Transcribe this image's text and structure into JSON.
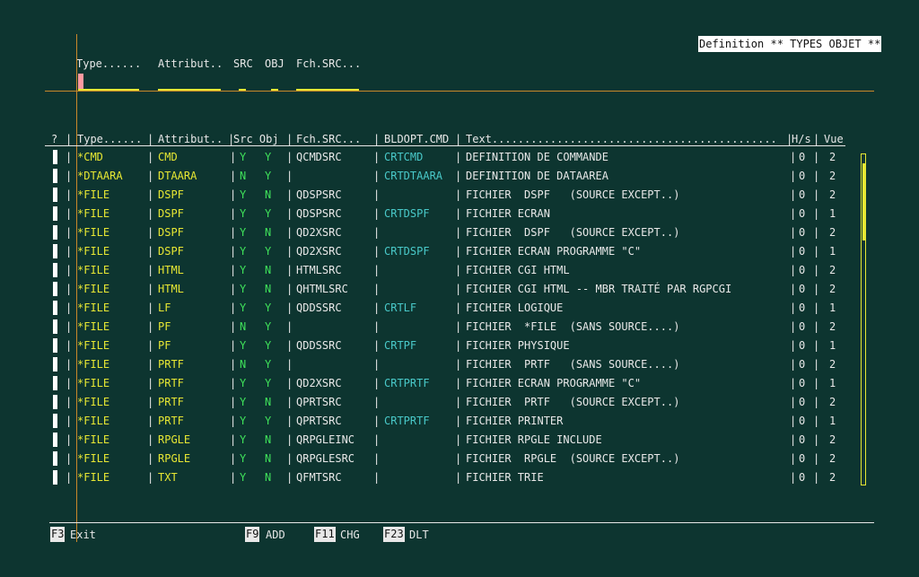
{
  "screen_title": "Definition ** TYPES OBJET **",
  "filter": {
    "type_label": "Type......",
    "attribut_label": "Attribut..",
    "src_label": "SRC",
    "obj_label": "OBJ",
    "fchsrc_label": "Fch.SRC..."
  },
  "columns": {
    "sel": "?",
    "type": "Type......",
    "attribut": "Attribut..",
    "srcobj": "Src Obj",
    "fchsrc": "Fch.SRC...",
    "bldopt": "BLDOPT.CMD",
    "text": "Text............................................",
    "hs": "H/s",
    "vue": "Vue"
  },
  "rows": [
    {
      "type": "*CMD",
      "attr": "CMD",
      "src": "Y",
      "obj": "Y",
      "fch": "QCMDSRC",
      "bld": "CRTCMD",
      "text": "DEFINITION DE COMMANDE",
      "hs": "0",
      "vue": "2"
    },
    {
      "type": "*DTAARA",
      "attr": "DTAARA",
      "src": "N",
      "obj": "Y",
      "fch": "",
      "bld": "CRTDTAARA",
      "text": "DEFINITION DE DATAAREA",
      "hs": "0",
      "vue": "2"
    },
    {
      "type": "*FILE",
      "attr": "DSPF",
      "src": "Y",
      "obj": "N",
      "fch": "QDSPSRC",
      "bld": "",
      "text": "FICHIER  DSPF   (SOURCE EXCEPT..)",
      "hs": "0",
      "vue": "2"
    },
    {
      "type": "*FILE",
      "attr": "DSPF",
      "src": "Y",
      "obj": "Y",
      "fch": "QDSPSRC",
      "bld": "CRTDSPF",
      "text": "FICHIER ECRAN",
      "hs": "0",
      "vue": "1"
    },
    {
      "type": "*FILE",
      "attr": "DSPF",
      "src": "Y",
      "obj": "N",
      "fch": "QD2XSRC",
      "bld": "",
      "text": "FICHIER  DSPF   (SOURCE EXCEPT..)",
      "hs": "0",
      "vue": "2"
    },
    {
      "type": "*FILE",
      "attr": "DSPF",
      "src": "Y",
      "obj": "Y",
      "fch": "QD2XSRC",
      "bld": "CRTDSPF",
      "text": "FICHIER ECRAN PROGRAMME \"C\"",
      "hs": "0",
      "vue": "1"
    },
    {
      "type": "*FILE",
      "attr": "HTML",
      "src": "Y",
      "obj": "N",
      "fch": "HTMLSRC",
      "bld": "",
      "text": "FICHIER CGI HTML",
      "hs": "0",
      "vue": "2"
    },
    {
      "type": "*FILE",
      "attr": "HTML",
      "src": "Y",
      "obj": "N",
      "fch": "QHTMLSRC",
      "bld": "",
      "text": "FICHIER CGI HTML -- MBR TRAITÉ PAR RGPCGI",
      "hs": "0",
      "vue": "2"
    },
    {
      "type": "*FILE",
      "attr": "LF",
      "src": "Y",
      "obj": "Y",
      "fch": "QDDSSRC",
      "bld": "CRTLF",
      "text": "FICHIER LOGIQUE",
      "hs": "0",
      "vue": "1"
    },
    {
      "type": "*FILE",
      "attr": "PF",
      "src": "N",
      "obj": "Y",
      "fch": "",
      "bld": "",
      "text": "FICHIER  *FILE  (SANS SOURCE....)",
      "hs": "0",
      "vue": "2"
    },
    {
      "type": "*FILE",
      "attr": "PF",
      "src": "Y",
      "obj": "Y",
      "fch": "QDDSSRC",
      "bld": "CRTPF",
      "text": "FICHIER PHYSIQUE",
      "hs": "0",
      "vue": "1"
    },
    {
      "type": "*FILE",
      "attr": "PRTF",
      "src": "N",
      "obj": "Y",
      "fch": "",
      "bld": "",
      "text": "FICHIER  PRTF   (SANS SOURCE....)",
      "hs": "0",
      "vue": "2"
    },
    {
      "type": "*FILE",
      "attr": "PRTF",
      "src": "Y",
      "obj": "Y",
      "fch": "QD2XSRC",
      "bld": "CRTPRTF",
      "text": "FICHIER ECRAN PROGRAMME \"C\"",
      "hs": "0",
      "vue": "1"
    },
    {
      "type": "*FILE",
      "attr": "PRTF",
      "src": "Y",
      "obj": "N",
      "fch": "QPRTSRC",
      "bld": "",
      "text": "FICHIER  PRTF   (SOURCE EXCEPT..)",
      "hs": "0",
      "vue": "2"
    },
    {
      "type": "*FILE",
      "attr": "PRTF",
      "src": "Y",
      "obj": "Y",
      "fch": "QPRTSRC",
      "bld": "CRTPRTF",
      "text": "FICHIER PRINTER",
      "hs": "0",
      "vue": "1"
    },
    {
      "type": "*FILE",
      "attr": "RPGLE",
      "src": "Y",
      "obj": "N",
      "fch": "QRPGLEINC",
      "bld": "",
      "text": "FICHIER RPGLE INCLUDE",
      "hs": "0",
      "vue": "2"
    },
    {
      "type": "*FILE",
      "attr": "RPGLE",
      "src": "Y",
      "obj": "N",
      "fch": "QRPGLESRC",
      "bld": "",
      "text": "FICHIER  RPGLE  (SOURCE EXCEPT..)",
      "hs": "0",
      "vue": "2"
    },
    {
      "type": "*FILE",
      "attr": "TXT",
      "src": "Y",
      "obj": "N",
      "fch": "QFMTSRC",
      "bld": "",
      "text": "FICHIER TRIE",
      "hs": "0",
      "vue": "2"
    }
  ],
  "function_keys": [
    {
      "key": "F3",
      "label": "Exit"
    },
    {
      "key": "F9",
      "label": "ADD"
    },
    {
      "key": "F11",
      "label": "CHG"
    },
    {
      "key": "F23",
      "label": "DLT"
    }
  ],
  "colors": {
    "background": "#0d3530",
    "yellow": "#e7e733",
    "green": "#3fe05a",
    "cyan": "#49c9c9",
    "rule": "#c9882a"
  }
}
